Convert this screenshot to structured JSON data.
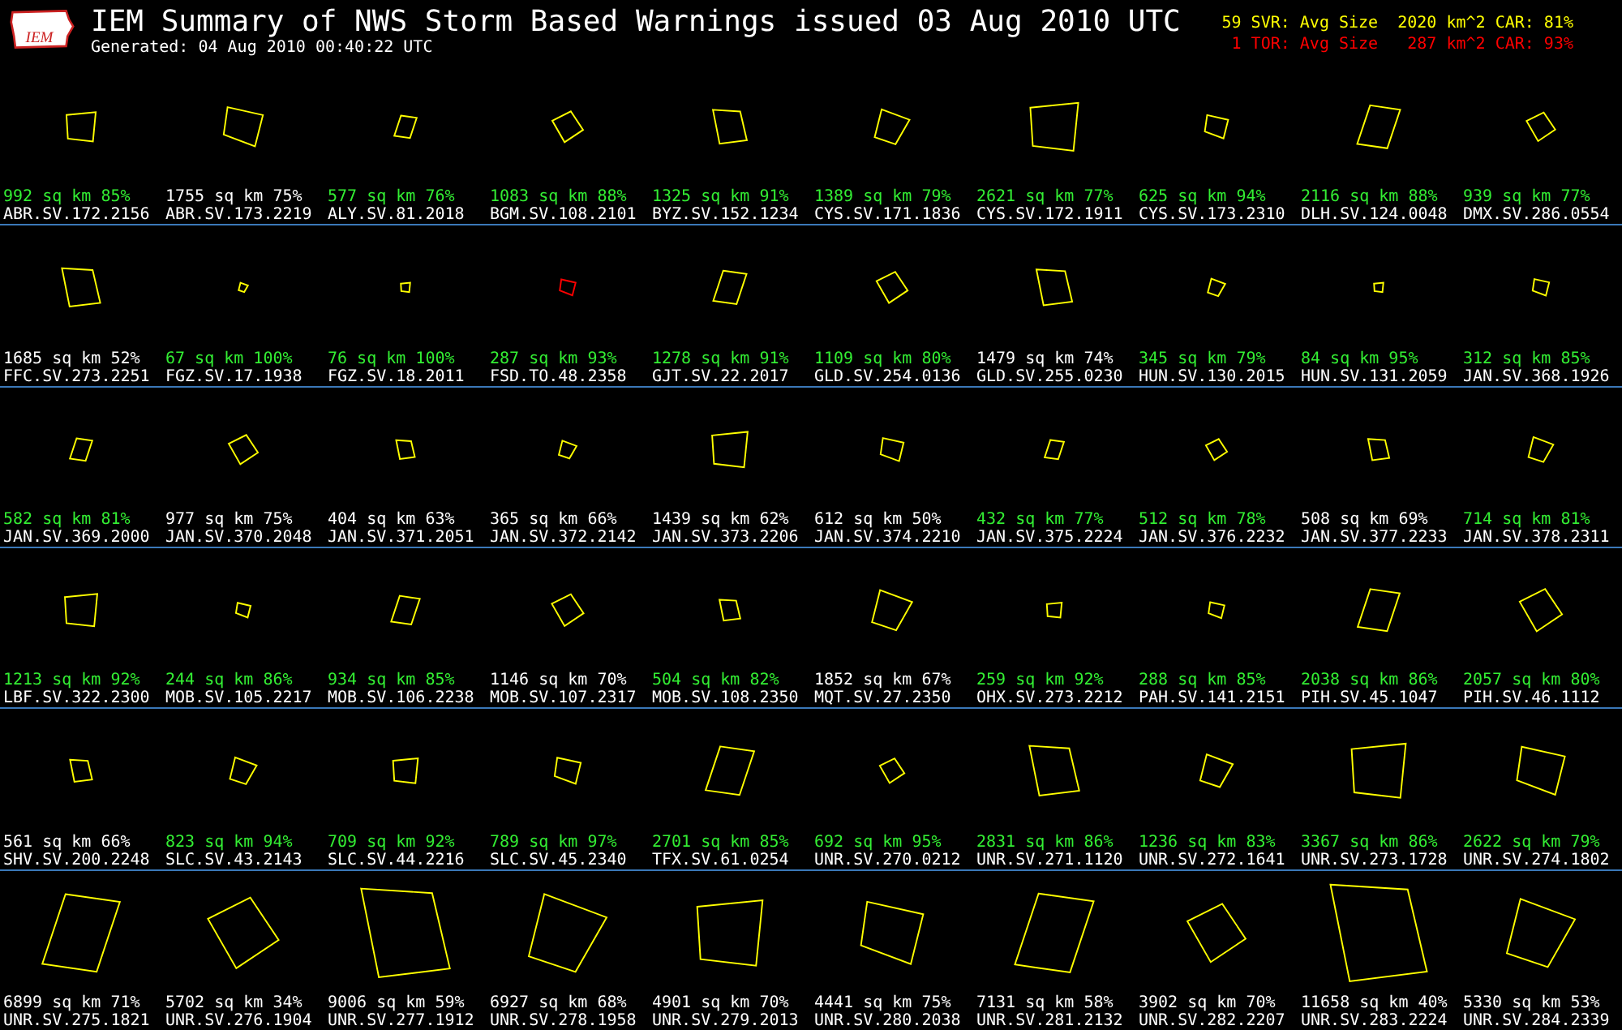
{
  "header": {
    "logo_text": "IEM",
    "title": "IEM Summary of NWS Storm Based Warnings issued 03 Aug 2010 UTC",
    "generated": "Generated: 04 Aug 2010 00:40:22 UTC",
    "stats": [
      {
        "kind": "svr",
        "text": "59 SVR: Avg Size  2020 km^2 CAR: 81%"
      },
      {
        "kind": "tor",
        "text": " 1 TOR: Avg Size   287 km^2 CAR: 93%"
      }
    ]
  },
  "rows": [
    {
      "cells": [
        {
          "stats": "992 sq km 85%",
          "id": "ABR.SV.172.2156",
          "kind": "svr",
          "highlight": true
        },
        {
          "stats": "1755 sq km 75%",
          "id": "ABR.SV.173.2219",
          "kind": "svr",
          "highlight": false
        },
        {
          "stats": "577 sq km 76%",
          "id": "ALY.SV.81.2018",
          "kind": "svr",
          "highlight": true
        },
        {
          "stats": "1083 sq km 88%",
          "id": "BGM.SV.108.2101",
          "kind": "svr",
          "highlight": true
        },
        {
          "stats": "1325 sq km 91%",
          "id": "BYZ.SV.152.1234",
          "kind": "svr",
          "highlight": true
        },
        {
          "stats": "1389 sq km 79%",
          "id": "CYS.SV.171.1836",
          "kind": "svr",
          "highlight": true
        },
        {
          "stats": "2621 sq km 77%",
          "id": "CYS.SV.172.1911",
          "kind": "svr",
          "highlight": true
        },
        {
          "stats": "625 sq km 94%",
          "id": "CYS.SV.173.2310",
          "kind": "svr",
          "highlight": true
        },
        {
          "stats": "2116 sq km 88%",
          "id": "DLH.SV.124.0048",
          "kind": "svr",
          "highlight": true
        },
        {
          "stats": "939 sq km 77%",
          "id": "DMX.SV.286.0554",
          "kind": "svr",
          "highlight": true
        }
      ]
    },
    {
      "cells": [
        {
          "stats": "1685 sq km 52%",
          "id": "FFC.SV.273.2251",
          "kind": "svr",
          "highlight": false
        },
        {
          "stats": "67 sq km 100%",
          "id": "FGZ.SV.17.1938",
          "kind": "svr",
          "highlight": true
        },
        {
          "stats": "76 sq km 100%",
          "id": "FGZ.SV.18.2011",
          "kind": "svr",
          "highlight": true
        },
        {
          "stats": "287 sq km 93%",
          "id": "FSD.TO.48.2358",
          "kind": "tor",
          "highlight": true
        },
        {
          "stats": "1278 sq km 91%",
          "id": "GJT.SV.22.2017",
          "kind": "svr",
          "highlight": true
        },
        {
          "stats": "1109 sq km 80%",
          "id": "GLD.SV.254.0136",
          "kind": "svr",
          "highlight": true
        },
        {
          "stats": "1479 sq km 74%",
          "id": "GLD.SV.255.0230",
          "kind": "svr",
          "highlight": false
        },
        {
          "stats": "345 sq km 79%",
          "id": "HUN.SV.130.2015",
          "kind": "svr",
          "highlight": true
        },
        {
          "stats": "84 sq km 95%",
          "id": "HUN.SV.131.2059",
          "kind": "svr",
          "highlight": true
        },
        {
          "stats": "312 sq km 85%",
          "id": "JAN.SV.368.1926",
          "kind": "svr",
          "highlight": true
        }
      ]
    },
    {
      "cells": [
        {
          "stats": "582 sq km 81%",
          "id": "JAN.SV.369.2000",
          "kind": "svr",
          "highlight": true
        },
        {
          "stats": "977 sq km 75%",
          "id": "JAN.SV.370.2048",
          "kind": "svr",
          "highlight": false
        },
        {
          "stats": "404 sq km 63%",
          "id": "JAN.SV.371.2051",
          "kind": "svr",
          "highlight": false
        },
        {
          "stats": "365 sq km 66%",
          "id": "JAN.SV.372.2142",
          "kind": "svr",
          "highlight": false
        },
        {
          "stats": "1439 sq km 62%",
          "id": "JAN.SV.373.2206",
          "kind": "svr",
          "highlight": false
        },
        {
          "stats": "612 sq km 50%",
          "id": "JAN.SV.374.2210",
          "kind": "svr",
          "highlight": false
        },
        {
          "stats": "432 sq km 77%",
          "id": "JAN.SV.375.2224",
          "kind": "svr",
          "highlight": true
        },
        {
          "stats": "512 sq km 78%",
          "id": "JAN.SV.376.2232",
          "kind": "svr",
          "highlight": true
        },
        {
          "stats": "508 sq km 69%",
          "id": "JAN.SV.377.2233",
          "kind": "svr",
          "highlight": false
        },
        {
          "stats": "714 sq km 81%",
          "id": "JAN.SV.378.2311",
          "kind": "svr",
          "highlight": true
        }
      ]
    },
    {
      "cells": [
        {
          "stats": "1213 sq km 92%",
          "id": "LBF.SV.322.2300",
          "kind": "svr",
          "highlight": true
        },
        {
          "stats": "244 sq km 86%",
          "id": "MOB.SV.105.2217",
          "kind": "svr",
          "highlight": true
        },
        {
          "stats": "934 sq km 85%",
          "id": "MOB.SV.106.2238",
          "kind": "svr",
          "highlight": true
        },
        {
          "stats": "1146 sq km 70%",
          "id": "MOB.SV.107.2317",
          "kind": "svr",
          "highlight": false
        },
        {
          "stats": "504 sq km 82%",
          "id": "MOB.SV.108.2350",
          "kind": "svr",
          "highlight": true
        },
        {
          "stats": "1852 sq km 67%",
          "id": "MQT.SV.27.2350",
          "kind": "svr",
          "highlight": false
        },
        {
          "stats": "259 sq km 92%",
          "id": "OHX.SV.273.2212",
          "kind": "svr",
          "highlight": true
        },
        {
          "stats": "288 sq km 85%",
          "id": "PAH.SV.141.2151",
          "kind": "svr",
          "highlight": true
        },
        {
          "stats": "2038 sq km 86%",
          "id": "PIH.SV.45.1047",
          "kind": "svr",
          "highlight": true
        },
        {
          "stats": "2057 sq km 80%",
          "id": "PIH.SV.46.1112",
          "kind": "svr",
          "highlight": true
        }
      ]
    },
    {
      "cells": [
        {
          "stats": "561 sq km 66%",
          "id": "SHV.SV.200.2248",
          "kind": "svr",
          "highlight": false
        },
        {
          "stats": "823 sq km 94%",
          "id": "SLC.SV.43.2143",
          "kind": "svr",
          "highlight": true
        },
        {
          "stats": "709 sq km 92%",
          "id": "SLC.SV.44.2216",
          "kind": "svr",
          "highlight": true
        },
        {
          "stats": "789 sq km 97%",
          "id": "SLC.SV.45.2340",
          "kind": "svr",
          "highlight": true
        },
        {
          "stats": "2701 sq km 85%",
          "id": "TFX.SV.61.0254",
          "kind": "svr",
          "highlight": true
        },
        {
          "stats": "692 sq km 95%",
          "id": "UNR.SV.270.0212",
          "kind": "svr",
          "highlight": true
        },
        {
          "stats": "2831 sq km 86%",
          "id": "UNR.SV.271.1120",
          "kind": "svr",
          "highlight": true
        },
        {
          "stats": "1236 sq km 83%",
          "id": "UNR.SV.272.1641",
          "kind": "svr",
          "highlight": true
        },
        {
          "stats": "3367 sq km 86%",
          "id": "UNR.SV.273.1728",
          "kind": "svr",
          "highlight": true
        },
        {
          "stats": "2622 sq km 79%",
          "id": "UNR.SV.274.1802",
          "kind": "svr",
          "highlight": true
        }
      ]
    },
    {
      "cells": [
        {
          "stats": "6899 sq km 71%",
          "id": "UNR.SV.275.1821",
          "kind": "svr",
          "highlight": false
        },
        {
          "stats": "5702 sq km 34%",
          "id": "UNR.SV.276.1904",
          "kind": "svr",
          "highlight": false
        },
        {
          "stats": "9006 sq km 59%",
          "id": "UNR.SV.277.1912",
          "kind": "svr",
          "highlight": false
        },
        {
          "stats": "6927 sq km 68%",
          "id": "UNR.SV.278.1958",
          "kind": "svr",
          "highlight": false
        },
        {
          "stats": "4901 sq km 70%",
          "id": "UNR.SV.279.2013",
          "kind": "svr",
          "highlight": false
        },
        {
          "stats": "4441 sq km 75%",
          "id": "UNR.SV.280.2038",
          "kind": "svr",
          "highlight": false
        },
        {
          "stats": "7131 sq km 58%",
          "id": "UNR.SV.281.2132",
          "kind": "svr",
          "highlight": false
        },
        {
          "stats": "3902 sq km 70%",
          "id": "UNR.SV.282.2207",
          "kind": "svr",
          "highlight": false
        },
        {
          "stats": "11658 sq km 40%",
          "id": "UNR.SV.283.2224",
          "kind": "svr",
          "highlight": false
        },
        {
          "stats": "5330 sq km 53%",
          "id": "UNR.SV.284.2339",
          "kind": "svr",
          "highlight": false
        }
      ]
    }
  ]
}
